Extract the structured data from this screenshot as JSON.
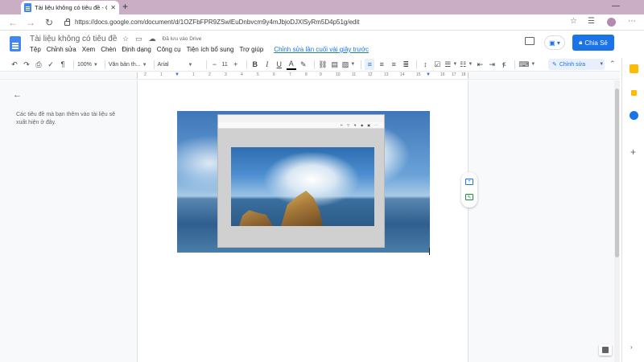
{
  "browser": {
    "tab_title": "Tài liệu không có tiêu đề - Goog",
    "tab_close": "✕",
    "new_tab": "+",
    "url": "https://docs.google.com/document/d/1OZFbFPR9ZSwlEuDnbvcm9y4mJbjoDJXlSyRm5D4p51g/edit",
    "minimize": "—"
  },
  "header": {
    "doc_title": "Tài liệu không có tiêu đề",
    "saved_status": "Đã lưu vào Drive",
    "share_label": "Chia Sẻ",
    "menu": [
      "Tệp",
      "Chỉnh sửa",
      "Xem",
      "Chèn",
      "Định dạng",
      "Công cụ",
      "Tiện ích bổ sung",
      "Trợ giúp"
    ],
    "last_edit": "Chỉnh sửa lần cuối vài giây trước"
  },
  "toolbar": {
    "zoom": "100%",
    "style": "Văn bản th...",
    "font": "Arial",
    "font_size": "11",
    "editing_mode": "Chỉnh sửa"
  },
  "ruler": {
    "numbers": [
      "2",
      "1",
      "1",
      "2",
      "3",
      "4",
      "5",
      "6",
      "7",
      "8",
      "9",
      "10",
      "11",
      "12",
      "13",
      "14",
      "15",
      "16",
      "17",
      "18"
    ]
  },
  "outline": {
    "text": "Các tiêu đề mà bạn thêm vào tài liệu sẽ xuất hiện ở đây."
  },
  "colors": {
    "accent": "#1a73e8",
    "titlebar": "#c9aec6",
    "docs_blue": "#4285f4"
  }
}
